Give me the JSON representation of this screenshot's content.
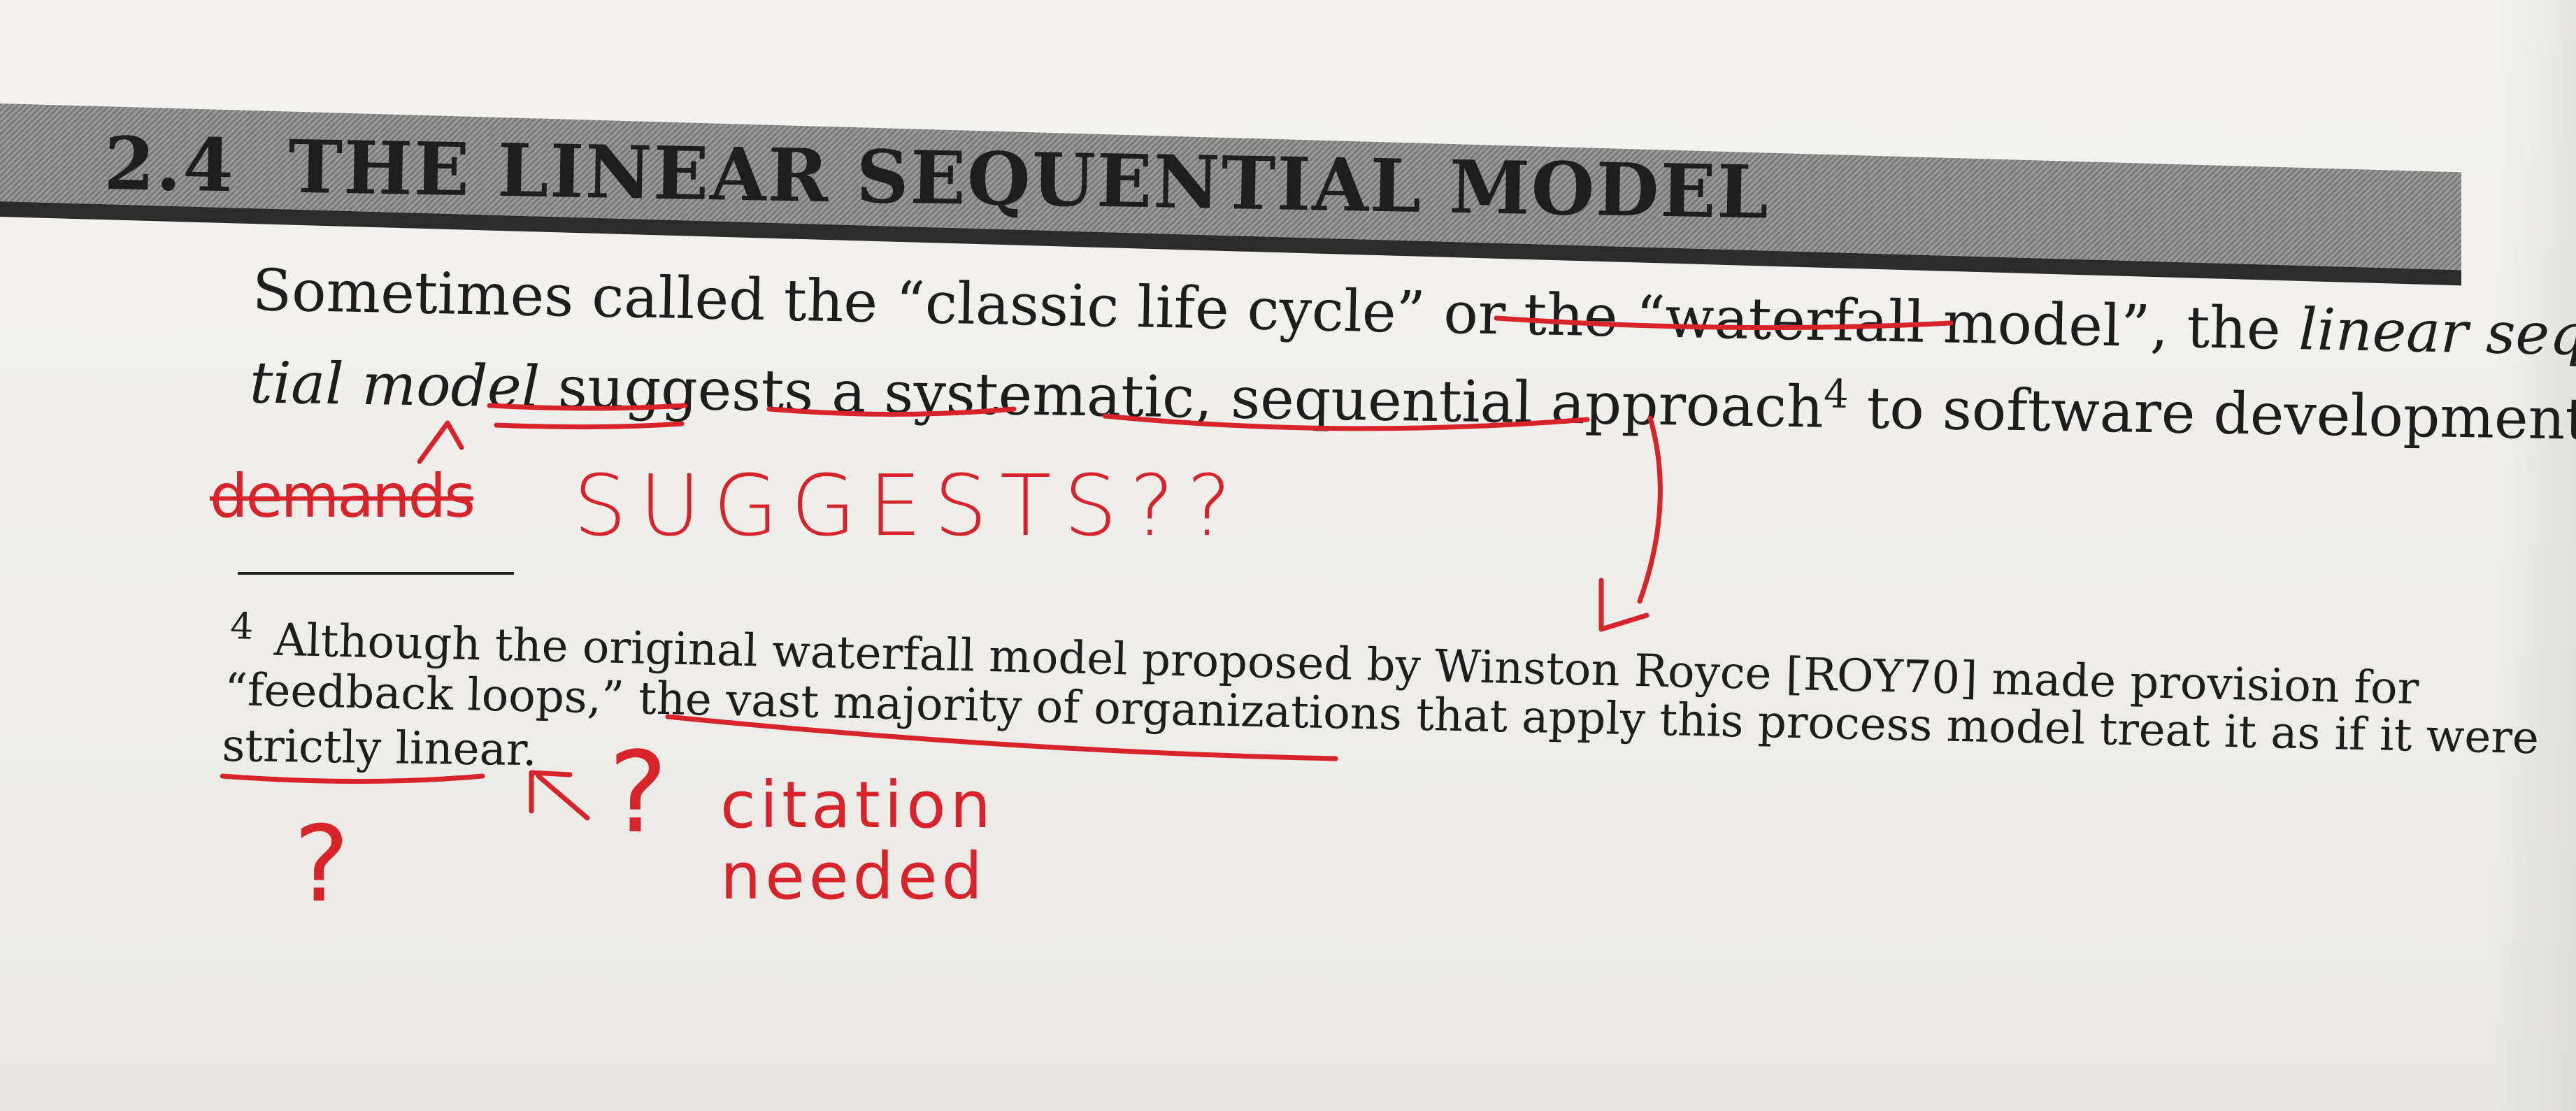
{
  "heading": {
    "number": "2.4",
    "title": "THE LINEAR SEQUENTIAL MODEL"
  },
  "paragraph": {
    "line1_a": "Sometimes called the “classic life cycle” or the “",
    "line1_b": "waterfall model",
    "line1_c": "”, the ",
    "line1_d": "linear sequen-",
    "line2_a": "tial model",
    "line2_b": " ",
    "line2_c": "suggests",
    "line2_d": " a ",
    "line2_e": "systematic",
    "line2_f": ", ",
    "line2_g": "sequential approach",
    "line2_sup": "4",
    "line2_h": " to software development that"
  },
  "footnote": {
    "number": "4",
    "line1": "Although the original waterfall model proposed by Winston Royce [ROY70] made provision for",
    "line2_a": "“feedback loops,” the ",
    "line2_b": "vast majority of organizations",
    "line2_c": " that apply this process model treat it as if it were",
    "line3": "strictly linear."
  },
  "annotations": {
    "struck_word": "demands",
    "replacement": "SUGGESTS??",
    "question_mark": "?",
    "question_mark_2": "?",
    "citation_line1": "citation",
    "citation_line2": "needed",
    "ink_color": "#d8232a"
  }
}
